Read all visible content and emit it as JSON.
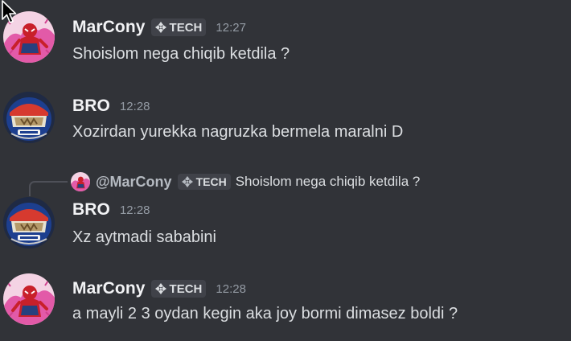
{
  "messages": [
    {
      "username": "MarCony",
      "tag": "TECH",
      "timestamp": "12:27",
      "content": "Shoislom nega chiqib ketdila ?",
      "avatar": "spiderman-avatar"
    },
    {
      "username": "BRO",
      "timestamp": "12:28",
      "content": "Xozirdan yurekka nagruzka bermela maralni D",
      "avatar": "nascar-helmet-avatar"
    },
    {
      "username": "BRO",
      "timestamp": "12:28",
      "content": "Xz aytmadi sababini",
      "avatar": "nascar-helmet-avatar",
      "reply": {
        "username": "@MarCony",
        "tag": "TECH",
        "content": "Shoislom nega chiqib ketdila ?"
      }
    },
    {
      "username": "MarCony",
      "tag": "TECH",
      "timestamp": "12:28",
      "content": "a mayli 2 3 oydan kegin aka joy bormi dimasez boldi ?",
      "avatar": "spiderman-avatar"
    }
  ],
  "colors": {
    "background": "#313338",
    "username": "#f2f3f5",
    "text": "#dbdee1",
    "timestamp": "#949ba4",
    "tag_bg": "#404249"
  }
}
